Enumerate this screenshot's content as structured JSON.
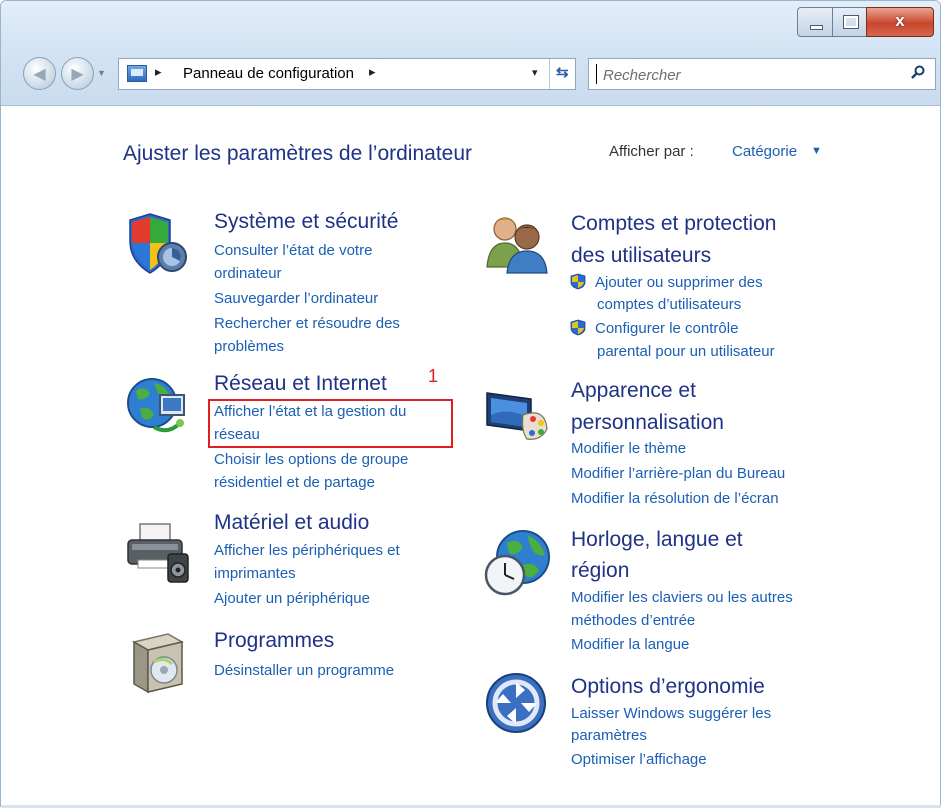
{
  "window": {
    "close_glyph": "x"
  },
  "address_bar": {
    "separator": "▸",
    "path": "Panneau de configuration",
    "dropdown_glyph": "▾"
  },
  "search": {
    "placeholder": "Rechercher"
  },
  "header": {
    "title": "Ajuster les paramètres de l’ordinateur",
    "view_by_label": "Afficher par :",
    "view_by_value": "Catégorie",
    "view_by_caret": "▼"
  },
  "categories_left": [
    {
      "title": "Système et sécurité",
      "icon": "shield-icon",
      "links": [
        "Consulter l’état de votre",
        "ordinateur",
        "Sauvegarder l’ordinateur",
        "Rechercher et résoudre des",
        "problèmes"
      ]
    },
    {
      "title": "Réseau et Internet",
      "icon": "network-globe-icon",
      "links": [
        "Afficher l’état et la gestion du",
        "réseau",
        "Choisir les options de groupe",
        "résidentiel et de partage"
      ]
    },
    {
      "title": "Matériel et audio",
      "icon": "printer-icon",
      "links": [
        "Afficher les périphériques et",
        "imprimantes",
        "Ajouter un périphérique"
      ]
    },
    {
      "title": "Programmes",
      "icon": "programs-box-icon",
      "links": [
        "Désinstaller un programme"
      ]
    }
  ],
  "categories_right": [
    {
      "title_lines": [
        "Comptes et protection",
        "des utilisateurs"
      ],
      "icon": "users-icon",
      "links": [
        "Ajouter ou supprimer des",
        "comptes d’utilisateurs",
        "Configurer le contrôle",
        "parental pour un utilisateur"
      ]
    },
    {
      "title_lines": [
        "Apparence et",
        "personnalisation"
      ],
      "icon": "monitor-palette-icon",
      "links": [
        "Modifier le thème",
        "Modifier l’arrière-plan du Bureau",
        "Modifier la résolution de l’écran"
      ]
    },
    {
      "title_lines": [
        "Horloge, langue et",
        "région"
      ],
      "icon": "clock-globe-icon",
      "links": [
        "Modifier les claviers ou les autres",
        "méthodes d’entrée",
        "Modifier la langue"
      ]
    },
    {
      "title_lines": [
        "Options d’ergonomie"
      ],
      "icon": "ease-of-access-icon",
      "links": [
        "Laisser Windows suggérer les",
        "paramètres",
        "Optimiser l’affichage"
      ]
    }
  ],
  "annotation": {
    "step_number": "1",
    "color": "#e02020"
  },
  "colors": {
    "heading": "#1e3287",
    "link": "#1a5fb4"
  }
}
